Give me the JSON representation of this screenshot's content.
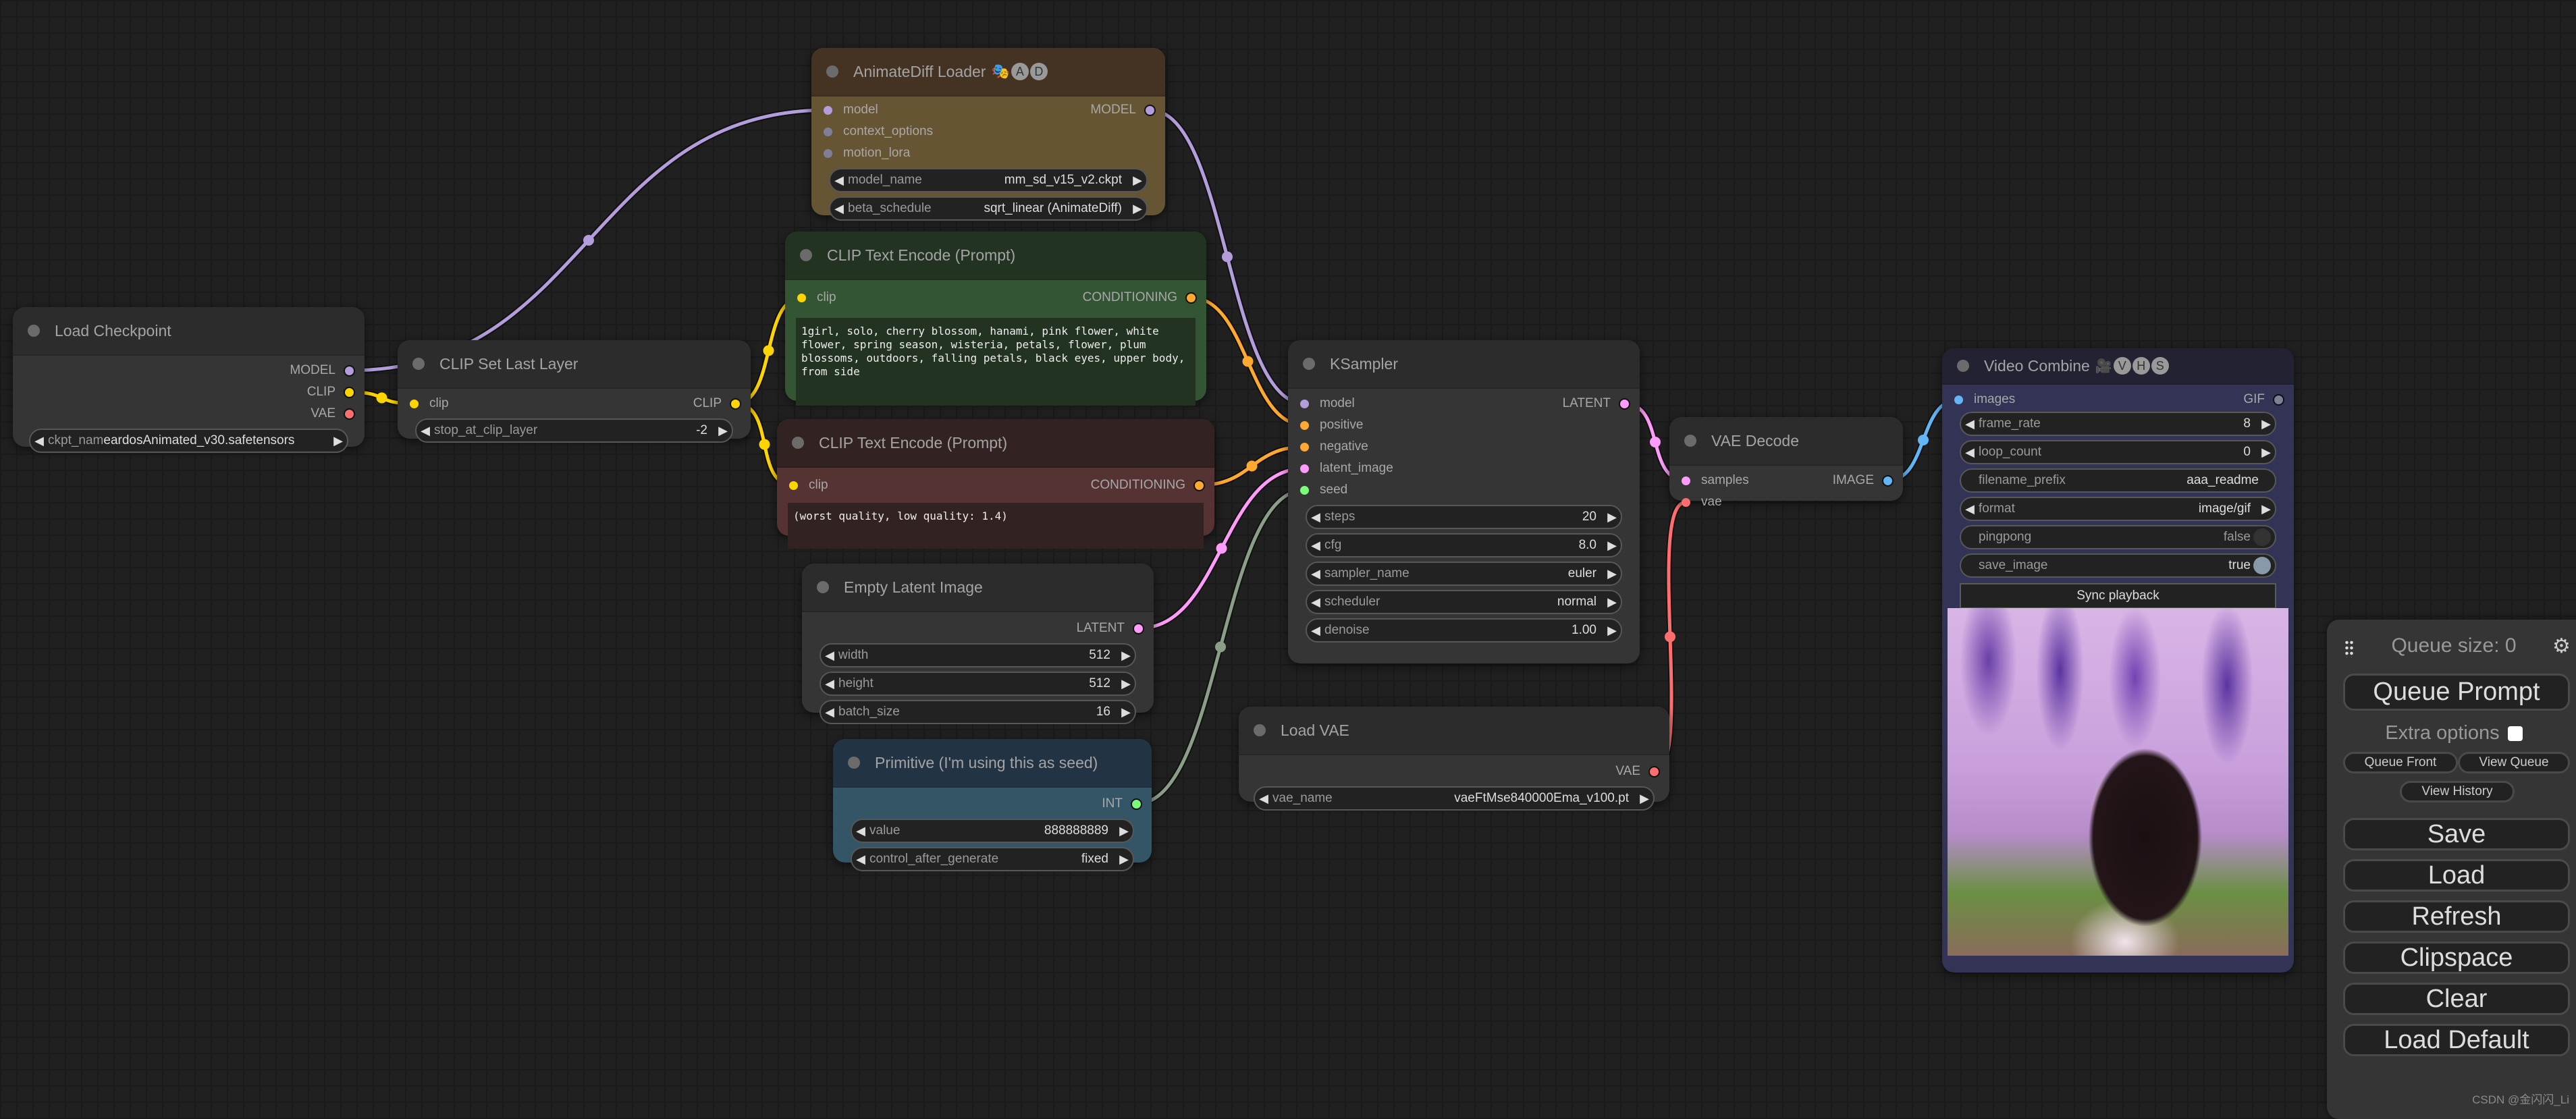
{
  "colors": {
    "model": "#b39ddb",
    "clip": "#ffd500",
    "vae": "#ff6e6e",
    "conditioning": "#ffa931",
    "latent": "#ff9cf9",
    "int": "#7cfc7c",
    "image": "#64b5f6",
    "seed_wire": "#8a9e88",
    "unconnected": "#7f7f9a"
  },
  "nodes": {
    "load_checkpoint": {
      "title": "Load Checkpoint",
      "outputs": [
        "MODEL",
        "CLIP",
        "VAE"
      ],
      "widgets": [
        {
          "label": "ckpt_nam",
          "value": "eardosAnimated_v30.safetensors"
        }
      ]
    },
    "clip_set_last_layer": {
      "title": "CLIP Set Last Layer",
      "inputs": [
        "clip"
      ],
      "outputs": [
        "CLIP"
      ],
      "widgets": [
        {
          "label": "stop_at_clip_layer",
          "value": "-2"
        }
      ]
    },
    "animatediff_loader": {
      "title": "AnimateDiff Loader",
      "title_badges": [
        "A",
        "D"
      ],
      "inputs": [
        "model",
        "context_options",
        "motion_lora"
      ],
      "outputs": [
        "MODEL"
      ],
      "widgets": [
        {
          "label": "model_name",
          "value": "mm_sd_v15_v2.ckpt"
        },
        {
          "label": "beta_schedule",
          "value": "sqrt_linear (AnimateDiff)"
        }
      ]
    },
    "clip_text_positive": {
      "title": "CLIP Text Encode (Prompt)",
      "inputs": [
        "clip"
      ],
      "outputs": [
        "CONDITIONING"
      ],
      "text": "1girl, solo, cherry blossom, hanami, pink flower, white flower, spring season, wisteria, petals, flower, plum blossoms, outdoors, falling petals, black eyes, upper body, from side"
    },
    "clip_text_negative": {
      "title": "CLIP Text Encode (Prompt)",
      "inputs": [
        "clip"
      ],
      "outputs": [
        "CONDITIONING"
      ],
      "text": "(worst quality, low quality: 1.4)"
    },
    "empty_latent": {
      "title": "Empty Latent Image",
      "outputs": [
        "LATENT"
      ],
      "widgets": [
        {
          "label": "width",
          "value": "512"
        },
        {
          "label": "height",
          "value": "512"
        },
        {
          "label": "batch_size",
          "value": "16"
        }
      ]
    },
    "primitive": {
      "title": "Primitive (I'm using this as seed)",
      "outputs": [
        "INT"
      ],
      "widgets": [
        {
          "label": "value",
          "value": "888888889"
        },
        {
          "label": "control_after_generate",
          "value": "fixed"
        }
      ]
    },
    "ksampler": {
      "title": "KSampler",
      "inputs": [
        "model",
        "positive",
        "negative",
        "latent_image",
        "seed"
      ],
      "outputs": [
        "LATENT"
      ],
      "widgets": [
        {
          "label": "steps",
          "value": "20"
        },
        {
          "label": "cfg",
          "value": "8.0"
        },
        {
          "label": "sampler_name",
          "value": "euler"
        },
        {
          "label": "scheduler",
          "value": "normal"
        },
        {
          "label": "denoise",
          "value": "1.00"
        }
      ]
    },
    "load_vae": {
      "title": "Load VAE",
      "outputs": [
        "VAE"
      ],
      "widgets": [
        {
          "label": "vae_name",
          "value": "vaeFtMse840000Ema_v100.pt"
        }
      ]
    },
    "vae_decode": {
      "title": "VAE Decode",
      "inputs": [
        "samples",
        "vae"
      ],
      "outputs": [
        "IMAGE"
      ]
    },
    "video_combine": {
      "title": "Video Combine",
      "title_badges": [
        "V",
        "H",
        "S"
      ],
      "inputs": [
        "images"
      ],
      "outputs": [
        "GIF"
      ],
      "widgets": [
        {
          "label": "frame_rate",
          "value": "8"
        },
        {
          "label": "loop_count",
          "value": "0"
        },
        {
          "label": "filename_prefix",
          "value": "aaa_readme"
        },
        {
          "label": "format",
          "value": "image/gif"
        },
        {
          "label": "pingpong",
          "value": "false"
        },
        {
          "label": "save_image",
          "value": "true"
        }
      ],
      "sync_button": "Sync playback",
      "preview_alt": "girl under wisteria trees"
    }
  },
  "panel": {
    "queue_size": "Queue size: 0",
    "queue_prompt": "Queue Prompt",
    "extra_options": "Extra options",
    "queue_front": "Queue Front",
    "view_queue": "View Queue",
    "view_history": "View History",
    "save": "Save",
    "load": "Load",
    "refresh": "Refresh",
    "clipspace": "Clipspace",
    "clear": "Clear",
    "load_default": "Load Default"
  },
  "watermark": "CSDN @金闪闪_Li"
}
